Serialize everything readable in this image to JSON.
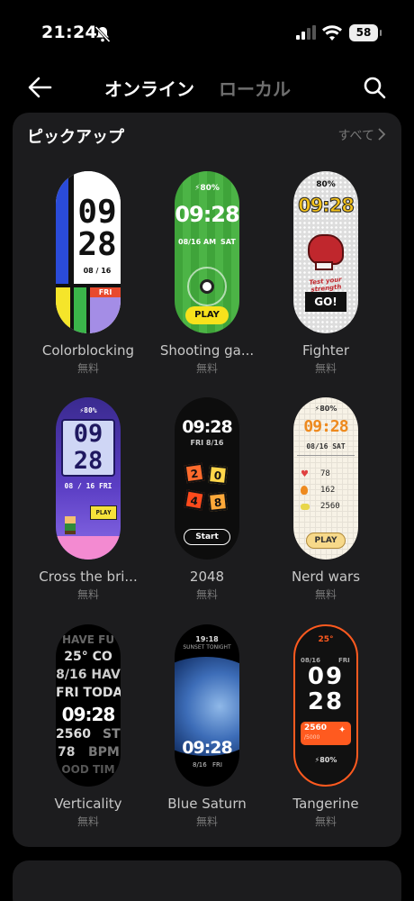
{
  "status": {
    "time": "21:24",
    "battery": "58"
  },
  "header": {
    "tab_online": "オンライン",
    "tab_local": "ローカル"
  },
  "section": {
    "title": "ピックアップ",
    "see_all": "すべて"
  },
  "items": [
    {
      "name": "Colorblocking",
      "price": "無料"
    },
    {
      "name": "Shooting ga...",
      "price": "無料"
    },
    {
      "name": "Fighter",
      "price": "無料"
    },
    {
      "name": "Cross the bri...",
      "price": "無料"
    },
    {
      "name": "2048",
      "price": "無料"
    },
    {
      "name": "Nerd wars",
      "price": "無料"
    },
    {
      "name": "Verticality",
      "price": "無料"
    },
    {
      "name": "Blue Saturn",
      "price": "無料"
    },
    {
      "name": "Tangerine",
      "price": "無料"
    }
  ],
  "faces": {
    "colorblocking": {
      "hour": "09",
      "minute": "28",
      "date": "08 / 16",
      "day": "FRI"
    },
    "shooting": {
      "battery": "⚡80%",
      "time": "09:28",
      "date": "08/16 AM",
      "day": "SAT",
      "button": "PLAY"
    },
    "fighter": {
      "battery": "80%",
      "time": "09:28",
      "slogan": "Test your strength",
      "button": "GO!"
    },
    "cross": {
      "battery": "⚡80%",
      "hour": "09",
      "minute": "28",
      "date": "08 / 16 FRI",
      "sign": "PLAY"
    },
    "g2048": {
      "time": "09:28",
      "date": "FRI 8/16",
      "tiles": [
        "2",
        "0",
        "4",
        "8"
      ],
      "button": "Start"
    },
    "nerd": {
      "battery": "⚡80%",
      "time": "09:28",
      "date": "08/16 SAT",
      "heart": "78",
      "flame": "162",
      "steps": "2560",
      "button": "PLAY"
    },
    "verticality": {
      "lines": [
        "HAVE FU",
        "25° CO",
        "8/16 HAV",
        "FRI TODA"
      ],
      "time": "09:28",
      "steps": "2560",
      "steps_tail": "ST",
      "bpm": "78",
      "bpm_tail": "BPM",
      "footer": "OOD TIM"
    },
    "saturn": {
      "small_time": "19:18",
      "caption": "SUNSET TONIGHT",
      "time": "09:28",
      "date": "8/16",
      "day": "FRI"
    },
    "tangerine": {
      "weather": "25°",
      "hour": "09",
      "minute": "28",
      "date": "08/16",
      "day": "FRI",
      "steps": "2560",
      "steps_sub": "/5000",
      "battery": "⚡80%"
    }
  },
  "colors": {
    "accent_tab": "#ffffff",
    "inactive_tab": "#6f6f6f",
    "card_bg": "#1c1c1e",
    "tangerine_orange": "#ff5a1f",
    "shooting_green": "#3fa43a"
  }
}
